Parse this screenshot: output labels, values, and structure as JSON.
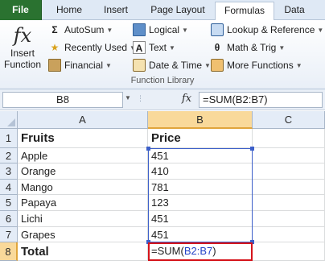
{
  "ribbon": {
    "tabs": [
      "File",
      "Home",
      "Insert",
      "Page Layout",
      "Formulas",
      "Data"
    ],
    "insert_function": {
      "symbol": "fx",
      "line1": "Insert",
      "line2": "Function"
    },
    "col1": [
      "AutoSum",
      "Recently Used",
      "Financial"
    ],
    "col2": [
      "Logical",
      "Text",
      "Date & Time"
    ],
    "col3": [
      "Lookup & Reference",
      "Math & Trig",
      "More Functions"
    ],
    "group_label": "Function Library"
  },
  "formula_bar": {
    "name_box": "B8",
    "fx": "fx",
    "formula": "=SUM(B2:B7)"
  },
  "grid": {
    "columns": [
      "A",
      "B",
      "C"
    ],
    "rows": [
      "1",
      "2",
      "3",
      "4",
      "5",
      "6",
      "7",
      "8"
    ],
    "cells": [
      [
        "Fruits",
        "Price",
        ""
      ],
      [
        "Apple",
        "451",
        ""
      ],
      [
        "Orange",
        "410",
        ""
      ],
      [
        "Mango",
        "781",
        ""
      ],
      [
        "Papaya",
        "123",
        ""
      ],
      [
        "Lichi",
        "451",
        ""
      ],
      [
        "Grapes",
        "451",
        ""
      ],
      [
        "Total",
        "",
        ""
      ]
    ],
    "active_cell_formula": {
      "prefix": "=SUM(",
      "ref": "B2:B7",
      "suffix": ")"
    }
  },
  "colors": {
    "file_tab": "#2a7230",
    "range_border": "#3c5fc9",
    "active_cell_border": "#d5141b",
    "selected_header": "#f9d99a"
  },
  "icons": [
    "insert-function-icon",
    "autosum-icon",
    "recently-used-icon",
    "financial-icon",
    "logical-icon",
    "text-icon",
    "date-time-icon",
    "lookup-reference-icon",
    "math-trig-icon",
    "more-functions-icon"
  ]
}
